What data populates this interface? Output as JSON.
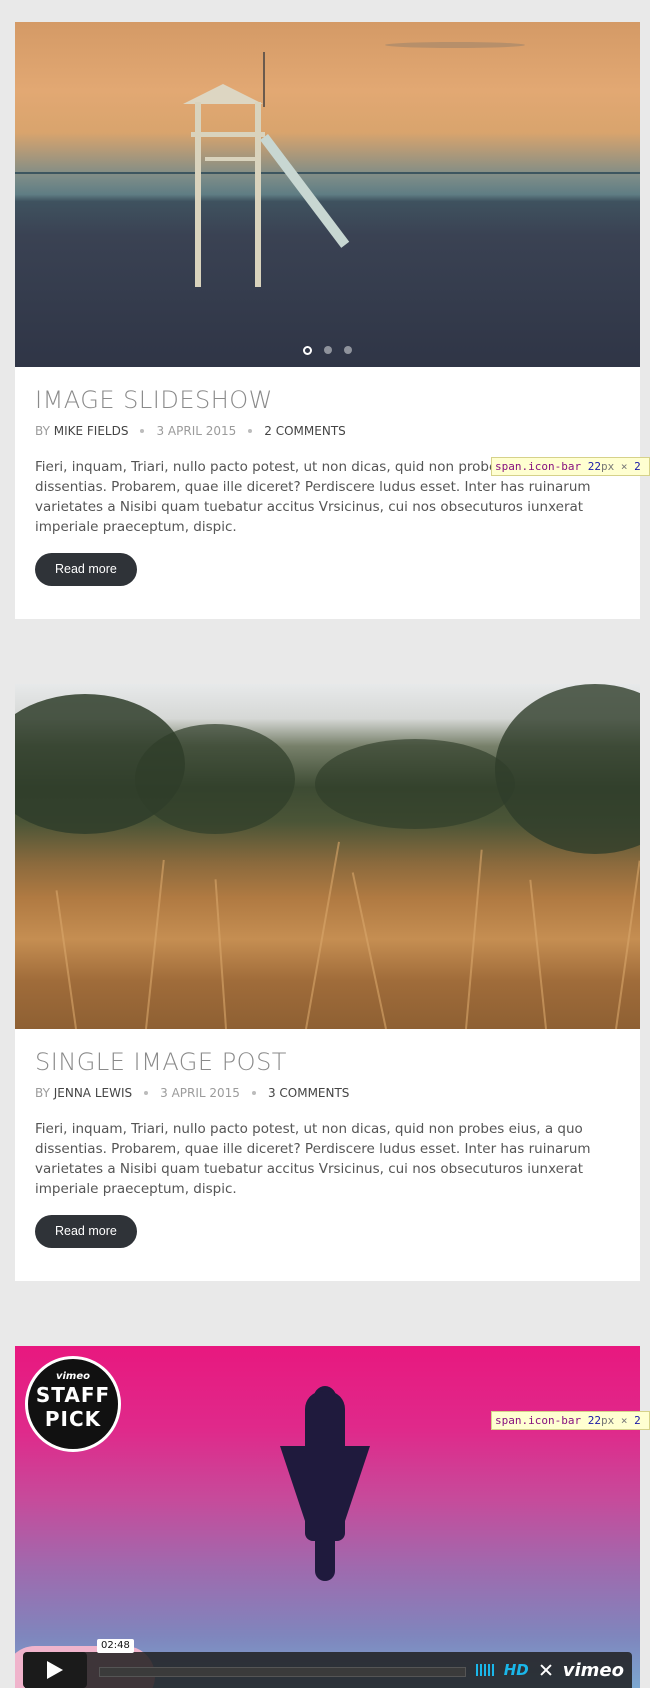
{
  "posts": [
    {
      "title": "IMAGE SLIDESHOW",
      "by_prefix": "BY",
      "author": "MIKE FIELDS",
      "date": "3 APRIL 2015",
      "comments": "2 COMMENTS",
      "excerpt": "Fieri, inquam, Triari, nullo pacto potest, ut non dicas, quid non probes eius, a quo dissentias. Probarem, quae ille diceret? Perdiscere ludus esset. Inter has ruinarum varietates a Nisibi quam tuebatur accitus Vrsicinus, cui nos obsecuturos iunxerat imperiale praeceptum, dispic.",
      "read_more": "Read more",
      "slider_dots": 3,
      "active_slide": 1
    },
    {
      "title": "SINGLE IMAGE POST",
      "by_prefix": "BY",
      "author": "JENNA LEWIS",
      "date": "3 APRIL 2015",
      "comments": "3 COMMENTS",
      "excerpt": "Fieri, inquam, Triari, nullo pacto potest, ut non dicas, quid non probes eius, a quo dissentias. Probarem, quae ille diceret? Perdiscere ludus esset. Inter has ruinarum varietates a Nisibi quam tuebatur accitus Vrsicinus, cui nos obsecuturos iunxerat imperiale praeceptum, dispic.",
      "read_more": "Read more"
    }
  ],
  "video": {
    "badge_vimeo": "vimeo",
    "badge_staff": "STAFF",
    "badge_pick": "PICK",
    "duration": "02:48",
    "hd_label": "HD",
    "brand": "vimeo",
    "accent_color": "#1ab7ea"
  },
  "devtools_tooltip": {
    "tag": "span.icon-bar",
    "width": "22",
    "unit": "px",
    "sep": "×",
    "height": "2"
  }
}
